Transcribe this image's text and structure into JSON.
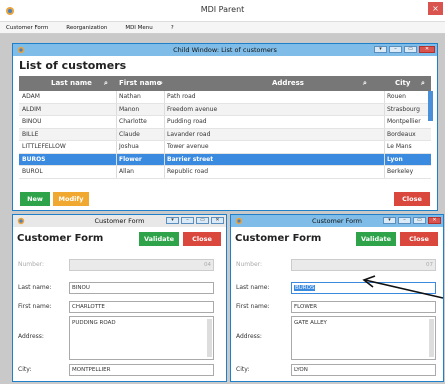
{
  "parent": {
    "title": "MDI Parent",
    "close": "×"
  },
  "menu": [
    "Customer Form",
    "Reorganization",
    "MDI Menu",
    "?"
  ],
  "list_window": {
    "title": "Child Window: List of customers",
    "heading": "List of customers",
    "columns": [
      "Last name",
      "First name",
      "Address",
      "City"
    ],
    "rows": [
      [
        "ADAM",
        "Nathan",
        "Path road",
        "Rouen"
      ],
      [
        "ALDIM",
        "Manon",
        "Freedom avenue",
        "Strasbourg"
      ],
      [
        "BINOU",
        "Charlotte",
        "Pudding road",
        "Montpellier"
      ],
      [
        "BILLE",
        "Claude",
        "Lavander road",
        "Bordeaux"
      ],
      [
        "LITTLEFELLOW",
        "Joshua",
        "Tower avenue",
        "Le Mans"
      ],
      [
        "BUROS",
        "Flower",
        "Barrier street",
        "Lyon"
      ],
      [
        "BUROL",
        "Allan",
        "Republic road",
        "Berkeley"
      ]
    ],
    "selected_row": 5,
    "new_label": "New",
    "modify_label": "Modify",
    "close_label": "Close"
  },
  "form_left": {
    "title": "Customer Form",
    "heading": "Customer Form",
    "validate_label": "Validate",
    "close_label": "Close",
    "number_label": "Number:",
    "number_value": "04",
    "last_name_label": "Last name:",
    "last_name": "BINOU",
    "first_name_label": "First name:",
    "first_name": "CHARLOTTE",
    "address_label": "Address:",
    "address": "PUDDING ROAD",
    "city_label": "City:",
    "city": "MONTPELLIER"
  },
  "form_right": {
    "title": "Customer Form",
    "heading": "Customer Form",
    "validate_label": "Validate",
    "close_label": "Close",
    "number_label": "Number:",
    "number_value": "07",
    "last_name_label": "Last name:",
    "last_name": "BUROS",
    "first_name_label": "First name:",
    "first_name": "FLOWER",
    "address_label": "Address:",
    "address": "GATE ALLEY",
    "city_label": "City:",
    "city": "LYON"
  }
}
